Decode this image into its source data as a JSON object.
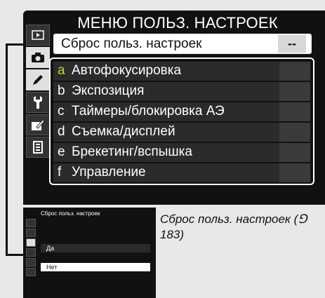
{
  "main_screen": {
    "title": "МЕНЮ ПОЛЬЗ. НАСТРОЕК",
    "reset_item": {
      "label": "Сброс польз. настроек",
      "value": "--"
    },
    "banks": [
      {
        "letter": "a",
        "name": "Автофокусировка",
        "color": "#c9d62a"
      },
      {
        "letter": "b",
        "name": "Экспозиция",
        "color": "#ffffff"
      },
      {
        "letter": "c",
        "name": "Таймеры/блокировка АЭ",
        "color": "#ffffff"
      },
      {
        "letter": "d",
        "name": "Съемка/дисплей",
        "color": "#ffffff"
      },
      {
        "letter": "e",
        "name": "Брекетинг/вспышка",
        "color": "#ffffff"
      },
      {
        "letter": "f",
        "name": "Управление",
        "color": "#ffffff"
      }
    ],
    "tabs": [
      "playback-icon",
      "camera-icon",
      "pencil-icon",
      "wrench-icon",
      "retouch-icon",
      "my-menu-icon"
    ]
  },
  "small_screen": {
    "title": "Сброс польз. настроек",
    "options": {
      "yes": "Да",
      "no": "Нет"
    }
  },
  "caption": "Сброс польз. настроек (⅁ 183)"
}
